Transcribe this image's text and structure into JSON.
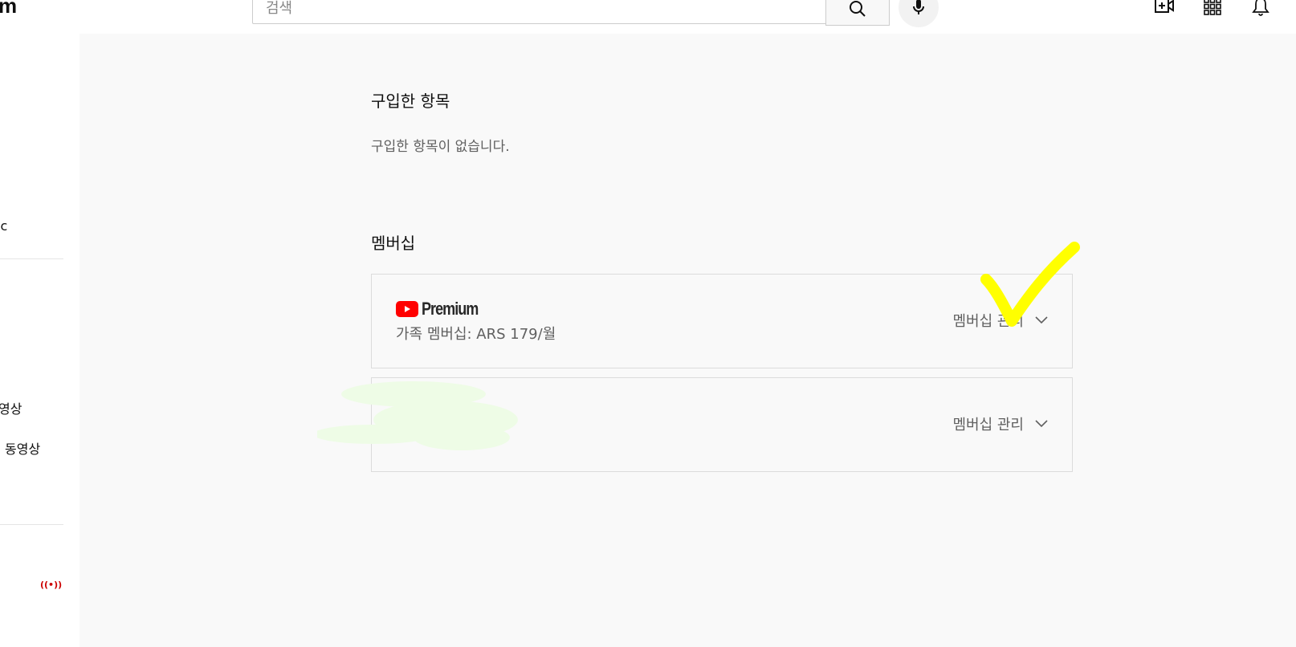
{
  "header": {
    "logo_fragment": "m",
    "search_placeholder": "검색",
    "icons": [
      "search-icon",
      "mic-icon",
      "create-video-icon",
      "apps-grid-icon",
      "notifications-bell-icon"
    ]
  },
  "sidebar": {
    "items": [
      {
        "label": "ic"
      },
      {
        "label": "영상"
      },
      {
        "label": "동영상"
      }
    ],
    "live_icon": "((•))"
  },
  "purchases": {
    "title": "구입한 항목",
    "empty_text": "구입한 항목이 없습니다."
  },
  "memberships": {
    "title": "멤버십",
    "cards": [
      {
        "brand": "Premium",
        "plan": "가족 멤버십: ARS 179/월",
        "manage_label": "멤버십 관리"
      },
      {
        "manage_label": "멤버십 관리"
      }
    ]
  },
  "colors": {
    "youtube_red": "#ff0000",
    "annotation_yellow": "#ffff00",
    "redaction_green": "#eefce6"
  }
}
